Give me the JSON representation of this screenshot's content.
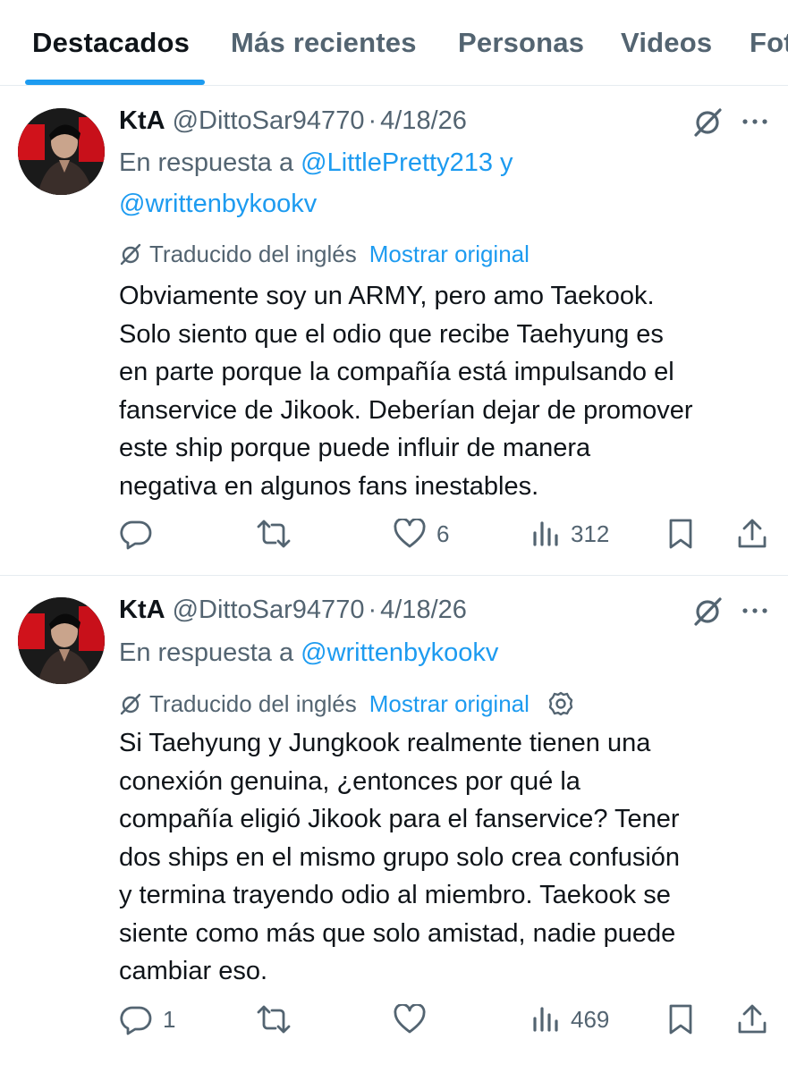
{
  "tabs": [
    {
      "label": "Destacados",
      "active": true
    },
    {
      "label": "Más recientes",
      "active": false
    },
    {
      "label": "Personas",
      "active": false
    },
    {
      "label": "Videos",
      "active": false
    },
    {
      "label": "Fotos",
      "active": false
    }
  ],
  "colors": {
    "accent": "#1d9bf0",
    "text": "#0f1419",
    "muted": "#536471",
    "divider": "#e6ecf0"
  },
  "tweets": [
    {
      "display_name": "KtA",
      "handle": "@DittoSar94770",
      "separator": "·",
      "date": "4/18/26",
      "reply_prefix": "En respuesta a",
      "reply_to_1": "@LittlePretty213",
      "reply_joiner": "y",
      "reply_to_2": "@writtenbykookv",
      "translated_label": "Traducido del inglés",
      "show_original": "Mostrar original",
      "text": "Obviamente soy un ARMY, pero amo Taekook.\nSolo siento que el odio que recibe Taehyung es\nen parte porque la compañía está impulsando el\nfanservice de Jikook. Deberían dejar de promover\neste ship porque puede influir de manera\nnegativa en algunos fans inestables.",
      "replies": "",
      "retweets": "",
      "likes": "6",
      "views": "312",
      "icons": [
        "no-translate-icon",
        "more-icon",
        "reply-icon",
        "retweet-icon",
        "like-icon",
        "views-icon",
        "bookmark-icon",
        "share-icon"
      ]
    },
    {
      "display_name": "KtA",
      "handle": "@DittoSar94770",
      "separator": "·",
      "date": "4/18/26",
      "reply_prefix": "En respuesta a",
      "reply_to_1": "@writtenbykookv",
      "translated_label": "Traducido del inglés",
      "show_original": "Mostrar original",
      "text": "Si Taehyung y Jungkook realmente tienen una\nconexión genuina, ¿entonces por qué la\ncompañía eligió Jikook para el fanservice? Tener\ndos ships en el mismo grupo solo crea confusión\ny termina trayendo odio al miembro. Taekook se\nsiente como más que solo amistad, nadie puede\ncambiar eso.",
      "replies": "1",
      "retweets": "",
      "likes": "",
      "views": "469",
      "icons": [
        "no-translate-icon",
        "more-icon",
        "settings-icon",
        "reply-icon",
        "retweet-icon",
        "like-icon",
        "views-icon",
        "bookmark-icon",
        "share-icon"
      ]
    }
  ]
}
